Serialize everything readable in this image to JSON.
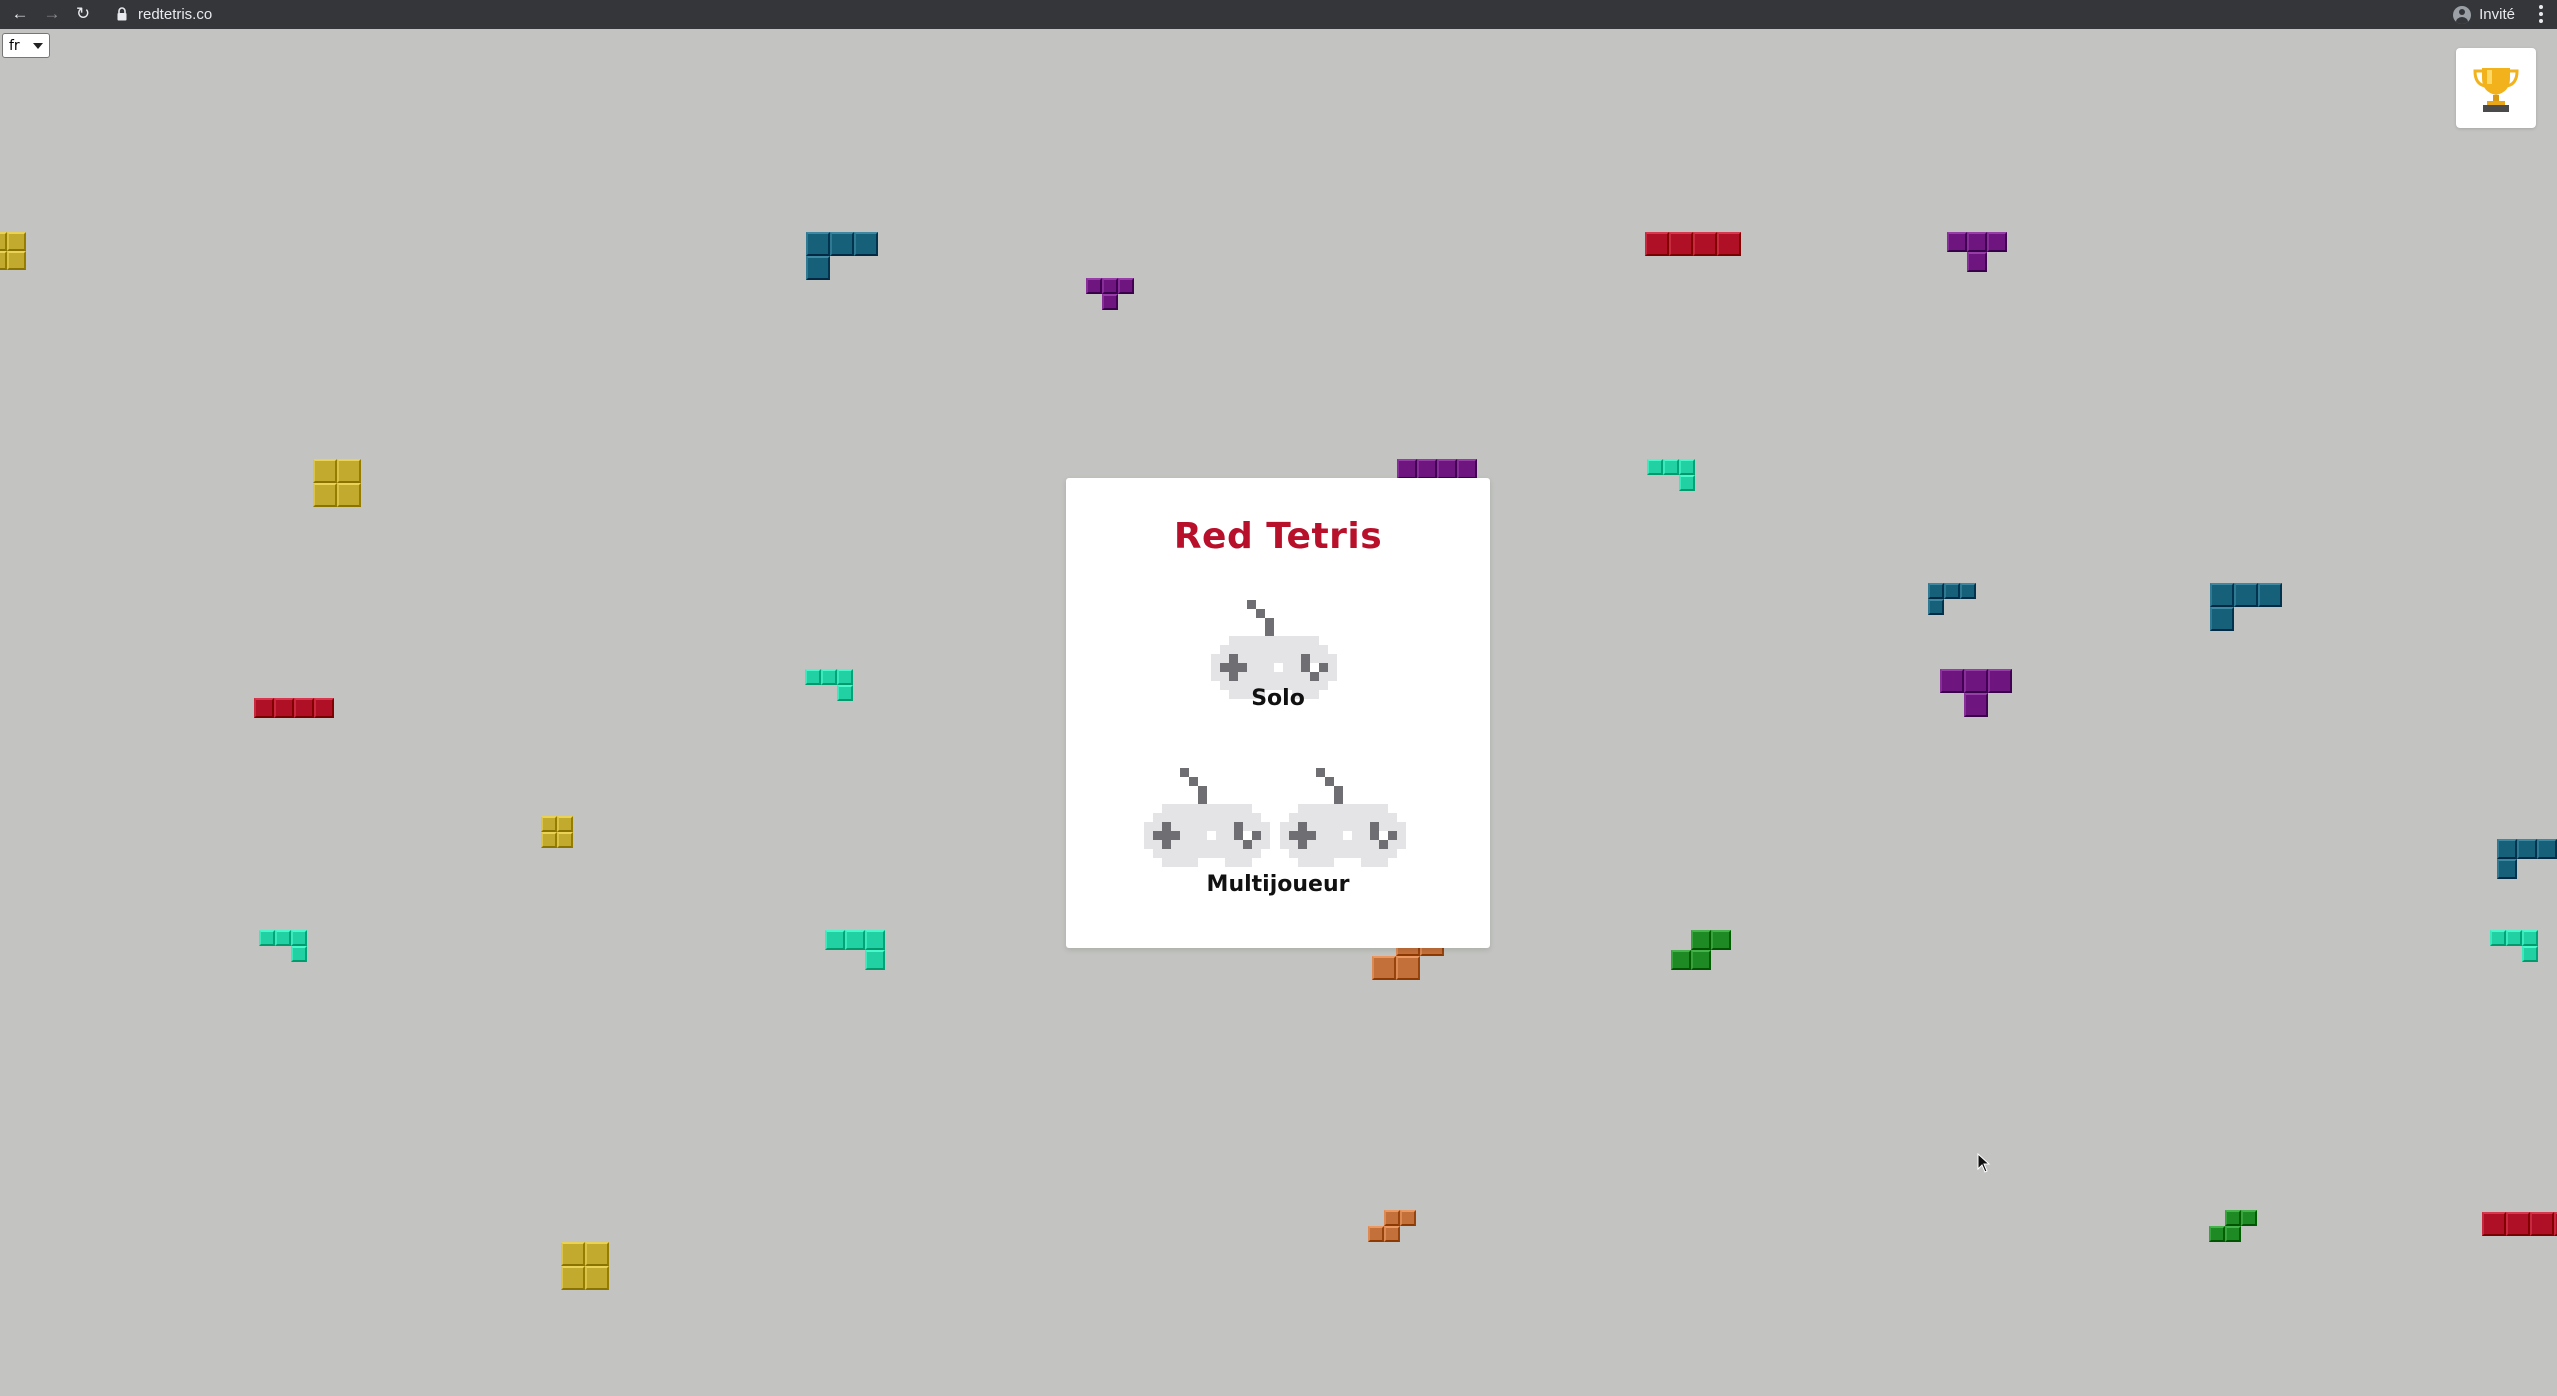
{
  "browser": {
    "url": "redtetris.co",
    "profile_label": "Invité"
  },
  "language": {
    "selected": "fr"
  },
  "game": {
    "title": "Red Tetris",
    "modes": {
      "solo_label": "Solo",
      "multi_label": "Multijoueur"
    }
  },
  "colors": {
    "background": "#c3c4c1",
    "title_red": "#b80f2b",
    "piece_yellow": "#c2aa2e",
    "piece_blue": "#17607a",
    "piece_purple": "#6e1580",
    "piece_red": "#b01025",
    "piece_cyan": "#21d1a4",
    "piece_green": "#1e8a24",
    "piece_orange": "#c4703a"
  },
  "icons": {
    "trophy": "trophy-icon",
    "controller": "gamepad-icon",
    "lock": "lock-icon"
  }
}
